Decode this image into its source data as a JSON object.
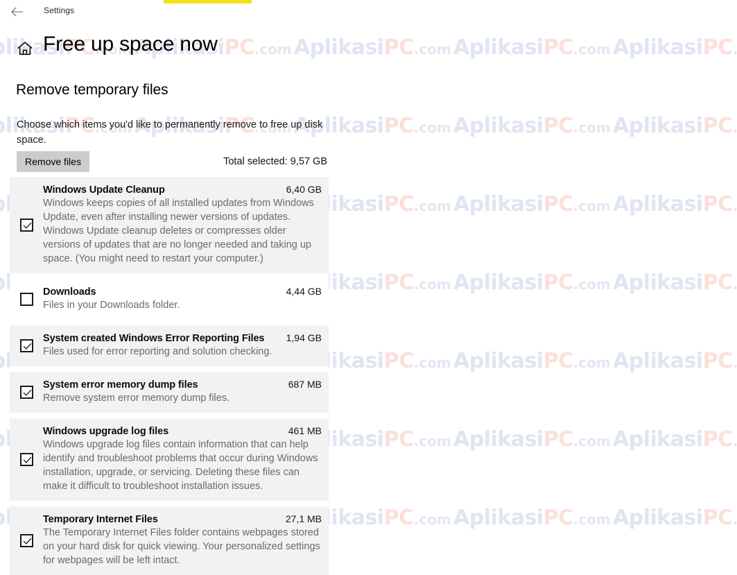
{
  "titlebar": {
    "back_icon": "back-arrow-icon",
    "label": "Settings"
  },
  "header": {
    "home_icon": "home-icon",
    "title": "Free up space now"
  },
  "main": {
    "section_heading": "Remove temporary files",
    "section_description": "Choose which items you'd like to permanently remove to free up disk space.",
    "remove_button_label": "Remove files",
    "total_selected": "Total selected: 9,57 GB"
  },
  "files": [
    {
      "name": "Windows Update Cleanup",
      "size": "6,40 GB",
      "description": "Windows keeps copies of all installed updates from Windows Update, even after installing newer versions of updates. Windows Update cleanup deletes or compresses older versions of updates that are no longer needed and taking up space. (You might need to restart your computer.)",
      "checked": true,
      "shaded": true
    },
    {
      "name": "Downloads",
      "size": "4,44 GB",
      "description": "Files in your Downloads folder.",
      "checked": false,
      "shaded": false
    },
    {
      "name": "System created Windows Error Reporting Files",
      "size": "1,94 GB",
      "description": "Files used for error reporting and solution checking.",
      "checked": true,
      "shaded": true
    },
    {
      "name": "System error memory dump files",
      "size": "687 MB",
      "description": "Remove system error memory dump files.",
      "checked": true,
      "shaded": true
    },
    {
      "name": "Windows upgrade log files",
      "size": "461 MB",
      "description": "Windows upgrade log files contain information that can help identify and troubleshoot problems that occur during Windows installation, upgrade, or servicing.  Deleting these files can make it difficult to troubleshoot installation issues.",
      "checked": true,
      "shaded": true
    },
    {
      "name": "Temporary Internet Files",
      "size": "27,1 MB",
      "description": "The Temporary Internet Files folder contains webpages stored on your hard disk for quick viewing. Your personalized settings for webpages will be left intact.",
      "checked": true,
      "shaded": true
    }
  ],
  "watermark": {
    "part_a": "Aplikasi",
    "part_b": "PC",
    "part_c": ".com"
  },
  "colors": {
    "accent_yellow": "#f5e016",
    "row_shade": "#f2f2f2",
    "button_gray": "#cccccc",
    "watermark_blue": "#dfe6f0",
    "watermark_pink": "#fbe0da"
  }
}
